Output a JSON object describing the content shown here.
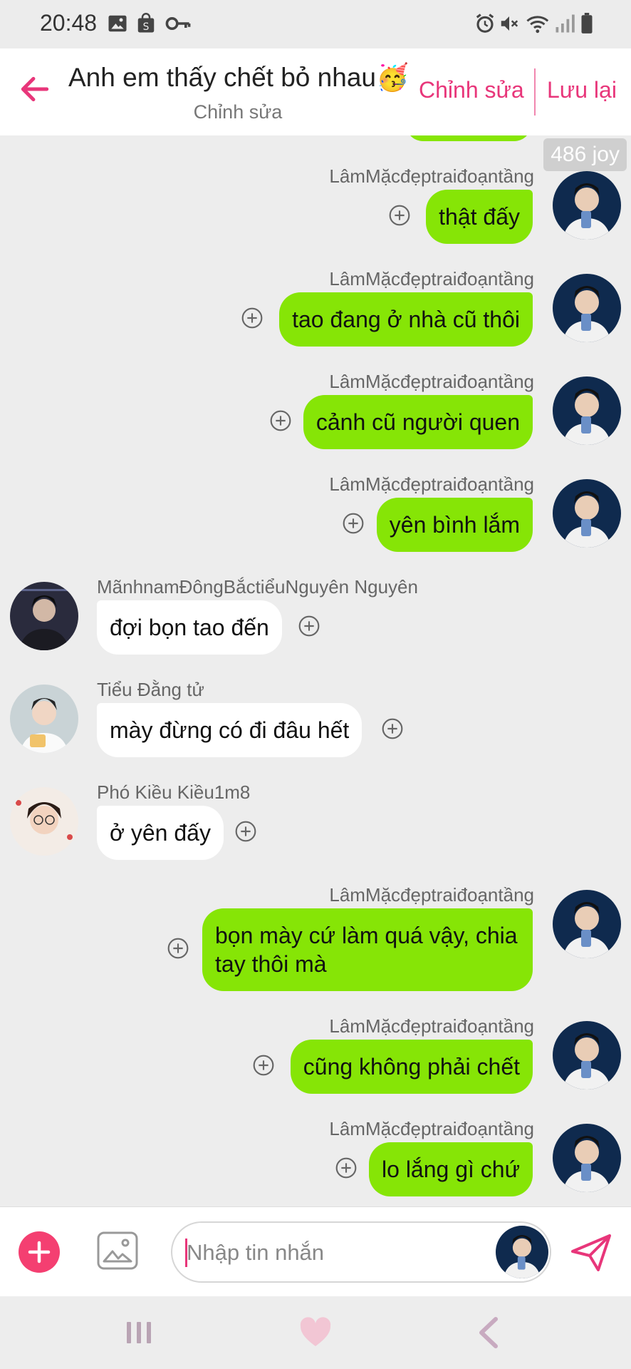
{
  "status_bar": {
    "time": "20:48",
    "left_icons": [
      "image-icon",
      "shop-bag-icon",
      "key-icon"
    ],
    "right_icons": [
      "alarm-icon",
      "mute-icon",
      "wifi-icon",
      "signal-icon",
      "battery-icon"
    ]
  },
  "header": {
    "title": "Anh em thấy chết bỏ nhau🥳",
    "subtitle": "Chỉnh sửa",
    "edit_label": "Chỉnh sửa",
    "save_label": "Lưu lại"
  },
  "joy_badge": "486 joy",
  "messages": [
    {
      "direction": "out",
      "sender": "LâmMặcđẹptraiđoạntầng",
      "text": "thật đấy"
    },
    {
      "direction": "out",
      "sender": "LâmMặcđẹptraiđoạntầng",
      "text": "tao đang ở nhà cũ thôi"
    },
    {
      "direction": "out",
      "sender": "LâmMặcđẹptraiđoạntầng",
      "text": "cảnh cũ người quen"
    },
    {
      "direction": "out",
      "sender": "LâmMặcđẹptraiđoạntầng",
      "text": "yên bình lắm"
    },
    {
      "direction": "in",
      "sender": "MãnhnamĐôngBắctiểuNguyên Nguyên",
      "text": "đợi bọn tao đến"
    },
    {
      "direction": "in",
      "sender": "Tiểu Đằng tử",
      "text": "mày đừng có đi đâu hết"
    },
    {
      "direction": "in",
      "sender": "Phó Kiều Kiều1m8",
      "text": "ở yên đấy"
    },
    {
      "direction": "out",
      "sender": "LâmMặcđẹptraiđoạntầng",
      "text": "bọn mày cứ làm quá vậy, chia tay thôi mà"
    },
    {
      "direction": "out",
      "sender": "LâmMặcđẹptraiđoạntầng",
      "text": "cũng không phải chết"
    },
    {
      "direction": "out",
      "sender": "LâmMặcđẹptraiđoạntầng",
      "text": "lo lắng gì chứ"
    }
  ],
  "input": {
    "placeholder": "Nhập tin nhắn"
  },
  "colors": {
    "accent": "#e8367a",
    "outgoing_bubble": "#86e506",
    "incoming_bubble": "#ffffff",
    "background": "#ededed"
  }
}
